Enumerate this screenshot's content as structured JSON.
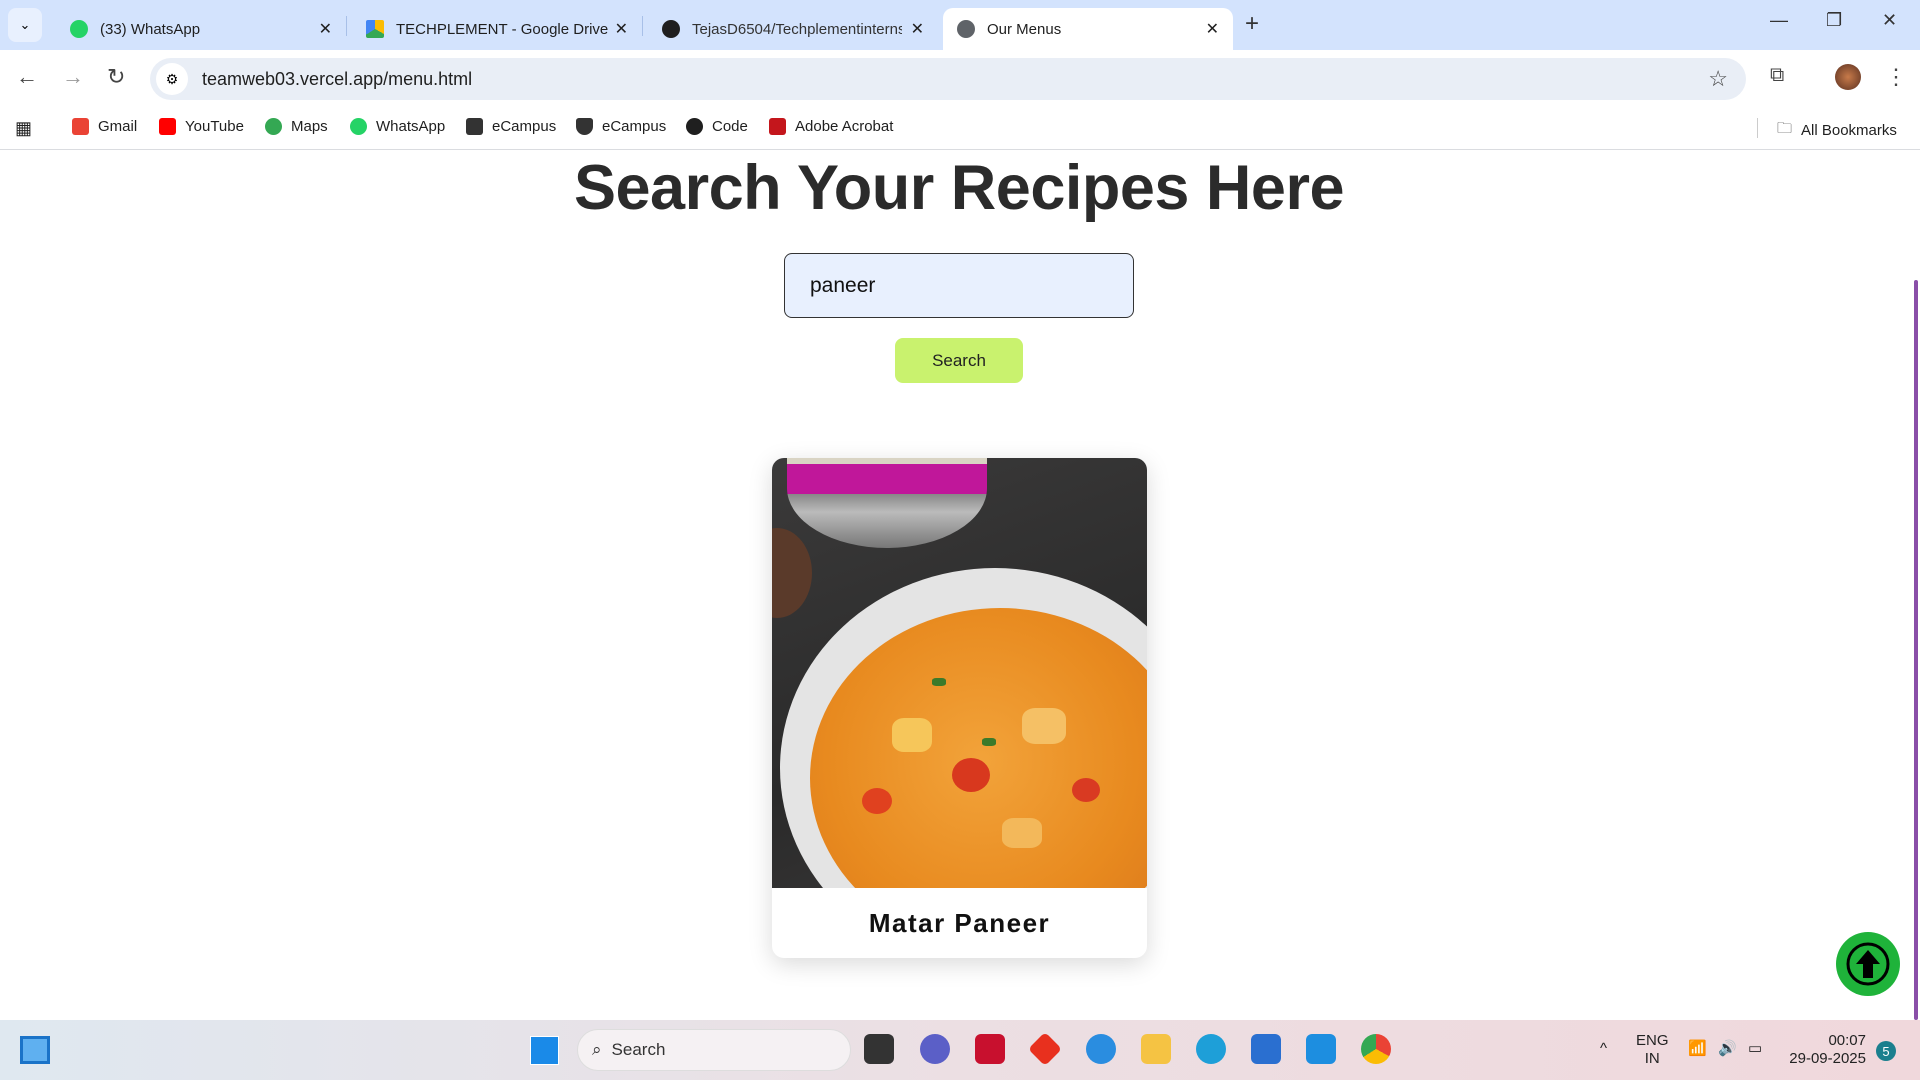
{
  "browser": {
    "tabs": [
      {
        "label": "(33) WhatsApp",
        "color": "#25d366"
      },
      {
        "label": "TECHPLEMENT - Google Drive",
        "color": "#fbbc04"
      },
      {
        "label": "TejasD6504/Techplementinterns",
        "color": "#1f1f1f"
      },
      {
        "label": "Our Menus",
        "color": "#5f6368"
      }
    ],
    "url": "teamweb03.vercel.app/menu.html",
    "bookmarks": [
      {
        "label": "Gmail",
        "color": "#ea4335"
      },
      {
        "label": "YouTube",
        "color": "#ff0000"
      },
      {
        "label": "Maps",
        "color": "#34a853"
      },
      {
        "label": "WhatsApp",
        "color": "#25d366"
      },
      {
        "label": "eCampus",
        "color": "#333333"
      },
      {
        "label": "eCampus",
        "color": "#333333"
      },
      {
        "label": "Code",
        "color": "#1f1f1f"
      },
      {
        "label": "Adobe Acrobat",
        "color": "#c4161c"
      }
    ],
    "all_bookmarks": "All Bookmarks"
  },
  "page": {
    "heading": "Search Your Recipes Here",
    "search_value": "paneer",
    "search_button": "Search",
    "results": [
      {
        "title": "Matar Paneer"
      }
    ]
  },
  "taskbar": {
    "search": "Search",
    "lang1": "ENG",
    "lang2": "IN",
    "time": "00:07",
    "date": "29-09-2025",
    "notifications": "5"
  }
}
